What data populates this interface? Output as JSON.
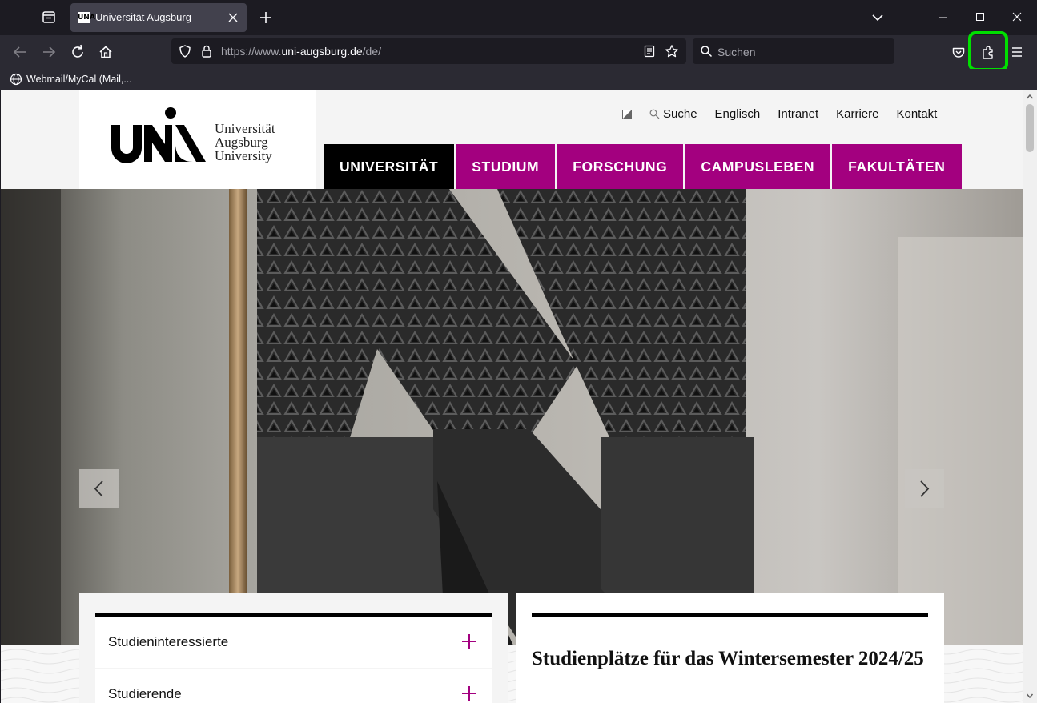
{
  "browser": {
    "tab": {
      "title": "Universität Augsburg",
      "favicon_text": "UNA"
    },
    "url": {
      "scheme": "https://www.",
      "host": "uni-augsburg.de",
      "path": "/de/"
    },
    "search_placeholder": "Suchen",
    "bookmarks": [
      {
        "label": "Webmail/MyCal (Mail,..."
      }
    ],
    "highlight_color": "#00e000"
  },
  "site": {
    "logo": {
      "line1": "Universität",
      "line2": "Augsburg",
      "line3": "University"
    },
    "service_nav": {
      "search": "Suche",
      "links": [
        "Englisch",
        "Intranet",
        "Karriere",
        "Kontakt"
      ]
    },
    "main_nav": [
      {
        "label": "UNIVERSITÄT",
        "active": true
      },
      {
        "label": "STUDIUM",
        "active": false
      },
      {
        "label": "FORSCHUNG",
        "active": false
      },
      {
        "label": "CAMPUSLEBEN",
        "active": false
      },
      {
        "label": "FAKULTÄTEN",
        "active": false
      }
    ],
    "accent_color": "#a3007f",
    "accordion": [
      {
        "label": "Studieninteressierte"
      },
      {
        "label": "Studierende"
      }
    ],
    "news": {
      "title": "Studienplätze für das Wintersemester 2024/25"
    }
  }
}
